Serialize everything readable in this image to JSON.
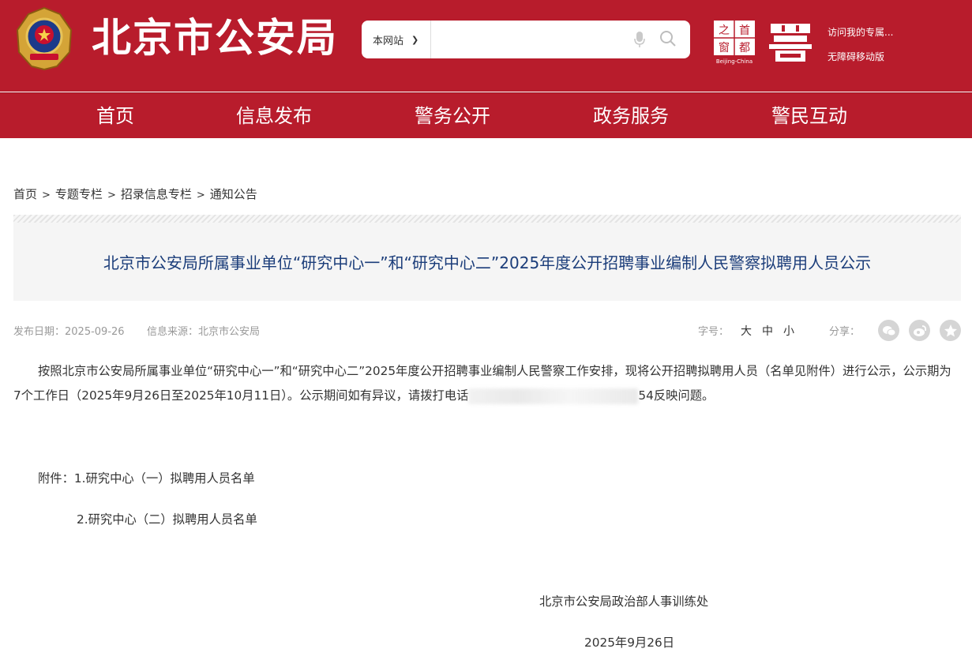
{
  "header": {
    "site_title": "北京市公安局",
    "search": {
      "scope": "本网站",
      "placeholder": ""
    },
    "capital_logo_text": "Beijing-China",
    "links": [
      "访问我的专属...",
      "无障碍移动版"
    ]
  },
  "nav": [
    "首页",
    "信息发布",
    "警务公开",
    "政务服务",
    "警民互动"
  ],
  "breadcrumb": [
    "首页",
    "专题专栏",
    "招录信息专栏",
    "通知公告"
  ],
  "breadcrumb_sep": ">",
  "article": {
    "title": "北京市公安局所属事业单位“研究中心一”和“研究中心二”2025年度公开招聘事业编制人民警察拟聘用人员公示",
    "date_label": "发布日期：2025-09-26",
    "source_label": "信息来源：北京市公安局",
    "font_size_label": "字号：",
    "font_sizes": [
      "大",
      "中",
      "小"
    ],
    "share_label": "分享：",
    "share_icons": [
      "wechat-icon",
      "weibo-icon",
      "favorite-icon"
    ],
    "paragraph_part1": "按照北京市公安局所属事业单位“研究中心一”和“研究中心二”2025年度公开招聘事业编制人民警察工作安排，现将公开招聘拟聘用人员（名单见附件）进行公示，公示期为7个工作日（2025年9月26日至2025年10月11日）。公示期间如有异议，请拨打电话",
    "paragraph_part2": "54反映问题。",
    "attachment_1": "附件：1.研究中心（一）拟聘用人员名单",
    "attachment_2": "2.研究中心（二）拟聘用人员名单",
    "signature": "北京市公安局政治部人事训练处",
    "sign_date": "2025年9月26日"
  },
  "colors": {
    "header_red": "#b81c2c",
    "title_blue": "#1b3d7a"
  }
}
